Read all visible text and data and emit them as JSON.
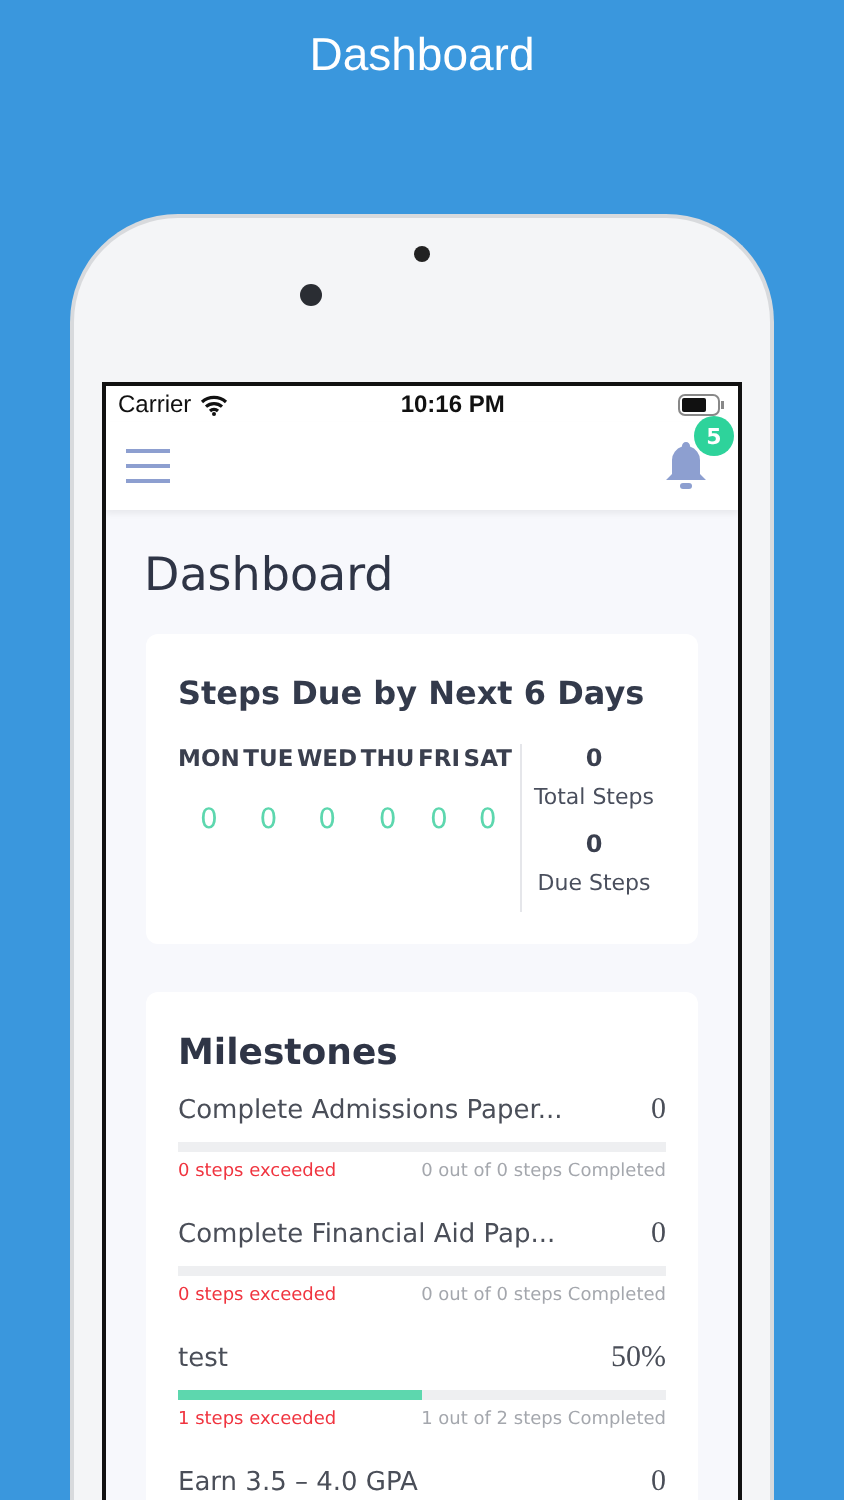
{
  "page_title": "Dashboard",
  "status_bar": {
    "carrier": "Carrier",
    "time": "10:16 PM"
  },
  "header": {
    "notification_count": "5"
  },
  "dashboard_title": "Dashboard",
  "steps_card": {
    "title": "Steps Due by Next 6 Days",
    "days": [
      {
        "label": "MON",
        "count": "0"
      },
      {
        "label": "TUE",
        "count": "0"
      },
      {
        "label": "WED",
        "count": "0"
      },
      {
        "label": "THU",
        "count": "0"
      },
      {
        "label": "FRI",
        "count": "0"
      },
      {
        "label": "SAT",
        "count": "0"
      }
    ],
    "totals": [
      {
        "value": "0",
        "label": "Total Steps"
      },
      {
        "value": "0",
        "label": "Due Steps"
      }
    ]
  },
  "milestones": {
    "title": "Milestones",
    "items": [
      {
        "name": "Complete Admissions Paper...",
        "value": "0",
        "level": 0,
        "exceeded": "0 steps exceeded",
        "completed": "0 out of 0 steps Completed"
      },
      {
        "name": "Complete Financial Aid Pap...",
        "value": "0",
        "level": 0,
        "exceeded": "0 steps exceeded",
        "completed": "0 out of 0 steps Completed"
      },
      {
        "name": "test",
        "value": "50%",
        "level": 0.5,
        "exceeded": "1 steps exceeded",
        "completed": "1 out of 2 steps Completed"
      },
      {
        "name": "Earn 3.5 – 4.0 GPA",
        "value": "0"
      }
    ]
  }
}
